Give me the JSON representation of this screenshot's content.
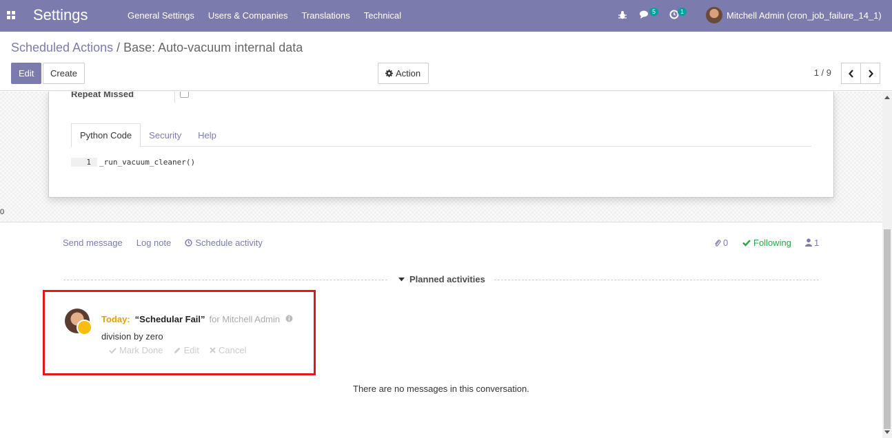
{
  "navbar": {
    "brand": "Settings",
    "menu": [
      "General Settings",
      "Users & Companies",
      "Translations",
      "Technical"
    ],
    "messages_count": "5",
    "activities_count": "1",
    "user_name": "Mitchell Admin (cron_job_failure_14_1)",
    "color": "#7c7bad"
  },
  "breadcrumb": {
    "parent": "Scheduled Actions",
    "separator": "/",
    "current": "Base: Auto-vacuum internal data"
  },
  "toolbar": {
    "edit_label": "Edit",
    "create_label": "Create",
    "action_label": "Action",
    "pager": "1 / 9"
  },
  "form": {
    "repeat_missed_label": "Repeat Missed",
    "tabs": [
      "Python Code",
      "Security",
      "Help"
    ],
    "code_line_number": "1",
    "code_text": "_run_vacuum_cleaner()",
    "stray_value": "0"
  },
  "chatter": {
    "send_message": "Send message",
    "log_note": "Log note",
    "schedule_activity": "Schedule activity",
    "attachments_count": "0",
    "following": "Following",
    "followers_count": "1",
    "planned_title": "Planned activities",
    "activity": {
      "date_label": "Today:",
      "summary": "“Schedular Fail”",
      "assigned": "for Mitchell Admin",
      "note": "division by zero",
      "mark_done": "Mark Done",
      "edit": "Edit",
      "cancel": "Cancel"
    },
    "no_messages": "There are no messages in this conversation."
  },
  "colors": {
    "highlight": "#e0161a",
    "today": "#e6a103",
    "following": "#28a745"
  }
}
